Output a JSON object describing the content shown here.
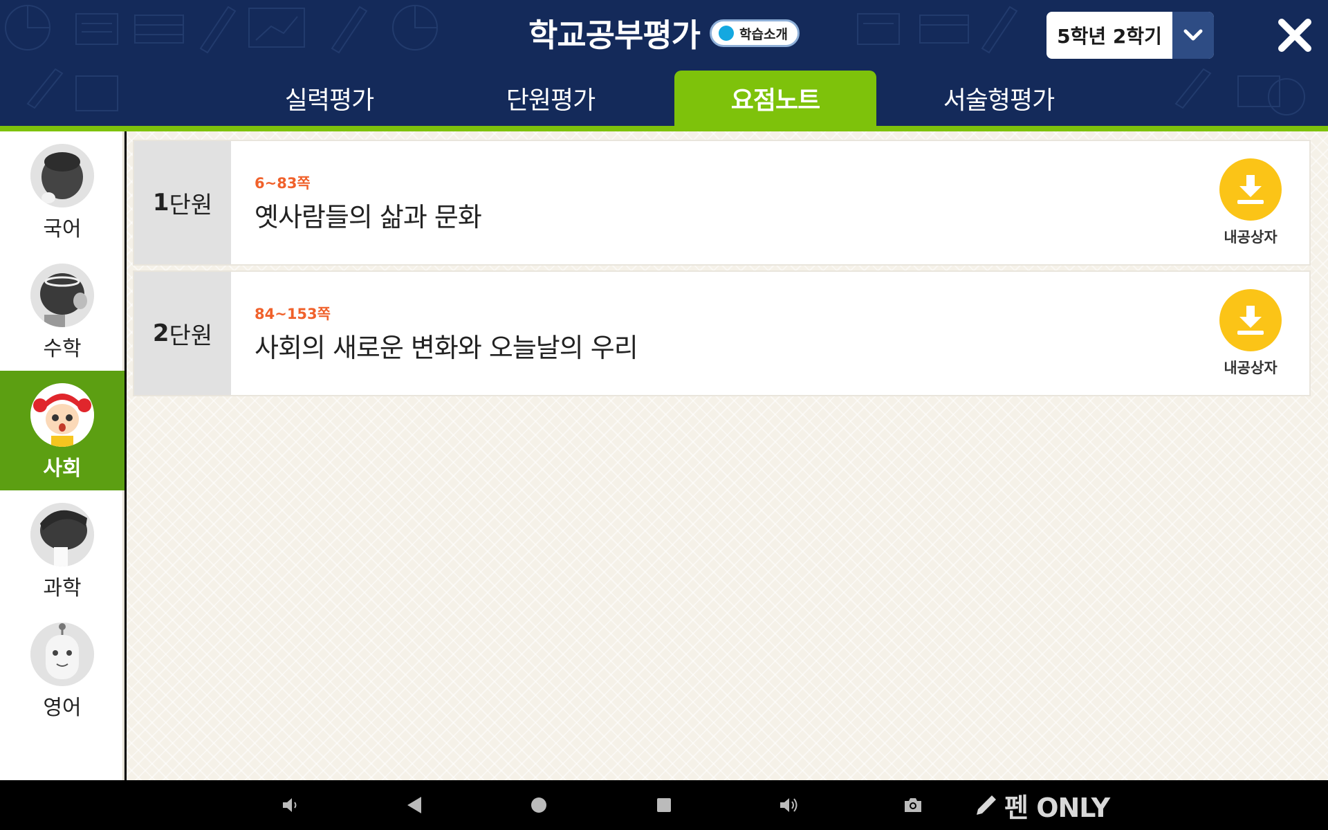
{
  "header": {
    "title": "학교공부평가",
    "intro_button": "학습소개",
    "grade_select": "5학년 2학기",
    "close_icon": "close-icon"
  },
  "tabs": [
    {
      "label": "실력평가",
      "active": false
    },
    {
      "label": "단원평가",
      "active": false
    },
    {
      "label": "요점노트",
      "active": true
    },
    {
      "label": "서술형평가",
      "active": false
    }
  ],
  "sidebar": {
    "items": [
      {
        "label": "국어",
        "active": false
      },
      {
        "label": "수학",
        "active": false
      },
      {
        "label": "사회",
        "active": true
      },
      {
        "label": "과학",
        "active": false
      },
      {
        "label": "영어",
        "active": false
      }
    ]
  },
  "units": [
    {
      "num": "1",
      "suffix": "단원",
      "pages": "6~83쪽",
      "title": "옛사람들의 삶과 문화",
      "download_label": "내공상자"
    },
    {
      "num": "2",
      "suffix": "단원",
      "pages": "84~153쪽",
      "title": "사회의 새로운 변화와 오늘날의 우리",
      "download_label": "내공상자"
    }
  ],
  "system_bar": {
    "pen_label": "펜 ONLY"
  },
  "colors": {
    "header_bg": "#142a5a",
    "accent_green": "#7ec20b",
    "sidebar_active": "#5c9f12",
    "download_yellow": "#fbc417",
    "page_orange": "#f0612b"
  }
}
